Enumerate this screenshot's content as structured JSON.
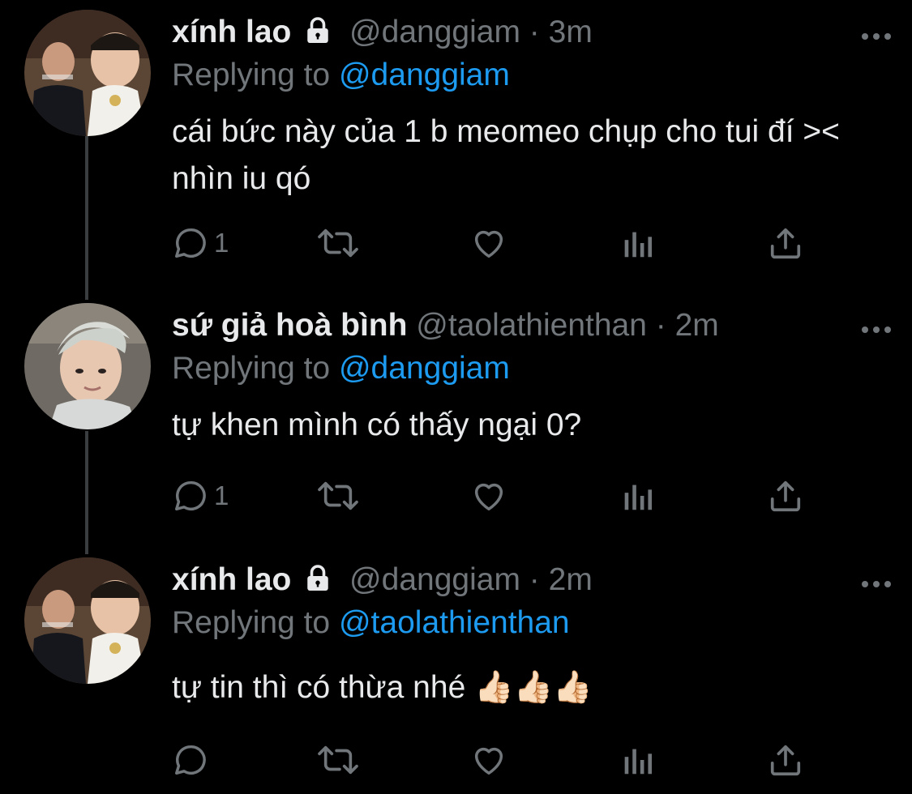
{
  "thread": [
    {
      "name": "xính lao",
      "protected": true,
      "handle": "@danggiam",
      "separator": "·",
      "time": "3m",
      "replying_prefix": "Replying to",
      "replying_to": "@danggiam",
      "text": "cái bức này của 1 b meomeo chụp cho tui đí >< nhìn iu qó",
      "reply_count": "1",
      "avatar": "man-with-chains-avatar"
    },
    {
      "name": "sứ giả hoà bình",
      "protected": false,
      "handle": "@taolathienthan",
      "separator": "·",
      "time": "2m",
      "replying_prefix": "Replying to",
      "replying_to": "@danggiam",
      "text": "tự khen mình có thấy ngại 0?",
      "reply_count": "1",
      "avatar": "silver-hair-avatar"
    },
    {
      "name": "xính lao",
      "protected": true,
      "handle": "@danggiam",
      "separator": "·",
      "time": "2m",
      "replying_prefix": "Replying to",
      "replying_to": "@taolathienthan",
      "text": "tự tin thì có thừa nhé 👍🏻👍🏻👍🏻",
      "reply_count": "",
      "avatar": "man-with-chains-avatar"
    }
  ],
  "colors": {
    "background": "#000000",
    "text": "#e7e9ea",
    "muted": "#71767b",
    "link": "#1d9bf0",
    "thread_line": "#3a3d40"
  },
  "icons": [
    "lock-icon",
    "more-icon",
    "reply-icon",
    "retweet-icon",
    "like-icon",
    "analytics-icon",
    "share-icon"
  ]
}
